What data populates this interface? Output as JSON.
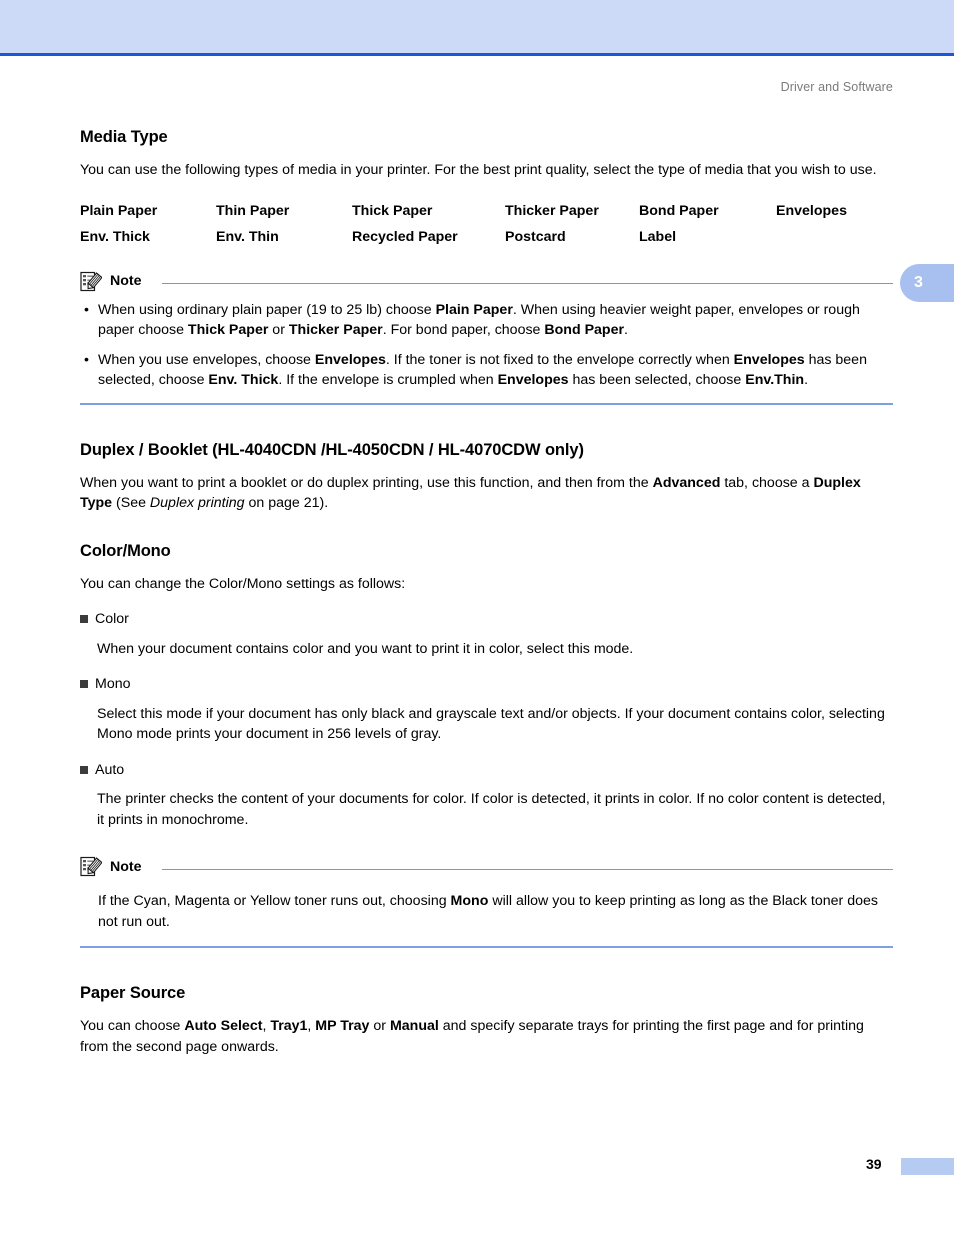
{
  "page": {
    "running_header": "Driver and Software",
    "chapter_tab": "3",
    "page_number": "39"
  },
  "media_type": {
    "heading": "Media Type",
    "intro": "You can use the following types of media in your printer. For the best print quality, select the type of media that you wish to use.",
    "grid": [
      "Plain Paper",
      "Thin Paper",
      "Thick Paper",
      "Thicker Paper",
      "Bond Paper",
      "Envelopes",
      "Env. Thick",
      "Env. Thin",
      "Recycled Paper",
      "Postcard",
      "Label",
      ""
    ],
    "note": {
      "label": "Note",
      "bullets": [
        {
          "p1": "When using ordinary plain paper (19 to 25 lb) choose ",
          "b1": "Plain Paper",
          "p2": ". When using heavier weight paper, envelopes or rough paper choose ",
          "b2": "Thick Paper",
          "p3": " or ",
          "b3": "Thicker Paper",
          "p4": ". For bond paper, choose ",
          "b4": "Bond Paper",
          "p5": "."
        },
        {
          "p1": "When you use envelopes, choose ",
          "b1": "Envelopes",
          "p2": ". If the toner is not fixed to the envelope correctly when ",
          "b2": "Envelopes",
          "p3": " has been selected, choose ",
          "b3": "Env. Thick",
          "p4": ". If the envelope is crumpled when ",
          "b4": "Envelopes",
          "p5": " has been selected, choose ",
          "b5": "Env.Thin",
          "p6": "."
        }
      ]
    }
  },
  "duplex": {
    "heading": "Duplex / Booklet (HL-4040CDN /HL-4050CDN / HL-4070CDW only)",
    "text_p1": "When you want to print a booklet or do duplex printing, use this function, and then from the ",
    "text_b1": "Advanced",
    "text_p2": " tab, choose a ",
    "text_b2": "Duplex Type",
    "text_p3": " (See ",
    "text_i1": "Duplex printing",
    "text_p4": " on page 21)."
  },
  "color_mono": {
    "heading": "Color/Mono",
    "intro": "You can change the Color/Mono settings as follows:",
    "items": [
      {
        "label": "Color",
        "description": "When your document contains color and you want to print it in color, select this mode."
      },
      {
        "label": "Mono",
        "description": "Select this mode if your document has only black and grayscale text and/or objects. If your document contains color, selecting Mono mode prints your document in 256 levels of gray."
      },
      {
        "label": "Auto",
        "description": "The printer checks the content of your documents for color. If color is detected, it prints in color. If no color content is detected, it prints in monochrome."
      }
    ],
    "note": {
      "label": "Note",
      "p1": "If the Cyan, Magenta or Yellow toner runs out, choosing ",
      "b1": "Mono",
      "p2": " will allow you to keep printing as long as the Black toner does not run out."
    }
  },
  "paper_source": {
    "heading": "Paper Source",
    "p1": "You can choose ",
    "b1": "Auto Select",
    "p2": ", ",
    "b2": "Tray1",
    "p3": ", ",
    "b3": "MP Tray",
    "p4": " or ",
    "b4": "Manual",
    "p5": " and specify separate trays for printing the first page and for printing from the second page onwards."
  },
  "colors": {
    "band": "#ccd9f7",
    "band_rule": "#1a56d6",
    "note_rule": "#7f9fe3",
    "tab": "#a8c0f0",
    "header_text": "#7b7b7b"
  }
}
